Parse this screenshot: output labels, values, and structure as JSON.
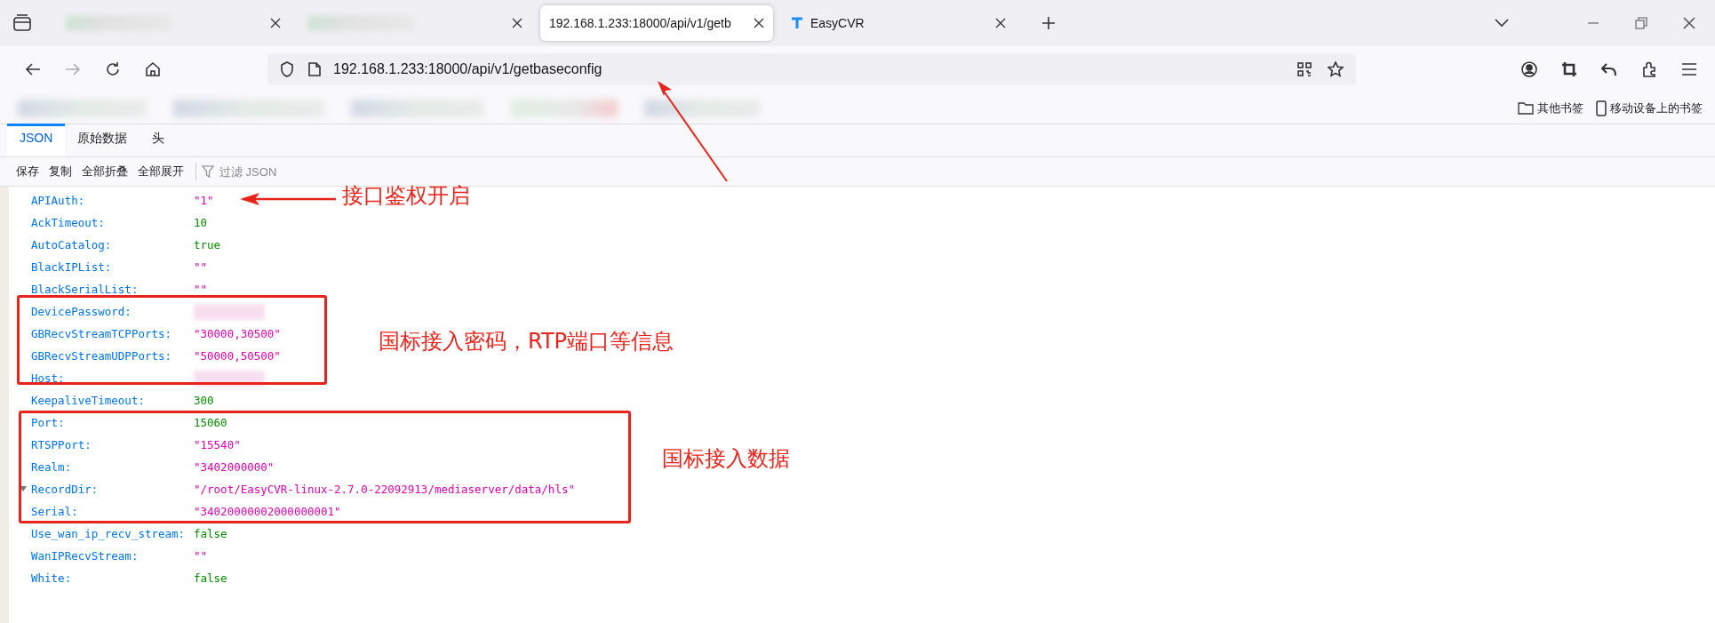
{
  "browser": {
    "tabs": [
      {
        "kind": "blurred",
        "selected": false
      },
      {
        "kind": "blurred",
        "selected": false
      },
      {
        "kind": "page",
        "title": "192.168.1.233:18000/api/v1/getb",
        "selected": true
      },
      {
        "kind": "page",
        "title": "EasyCVR",
        "selected": false
      }
    ],
    "url": "192.168.1.233:18000/api/v1/getbaseconfig",
    "bookmark_folders": [
      {
        "kind": "folder",
        "label": "其他书签"
      },
      {
        "kind": "mobile",
        "label": "移动设备上的书签"
      }
    ]
  },
  "viewer": {
    "tabs": [
      {
        "label": "JSON",
        "selected": true
      },
      {
        "label": "原始数据",
        "selected": false
      },
      {
        "label": "头",
        "selected": false
      }
    ],
    "toolbar": [
      "保存",
      "复制",
      "全部折叠",
      "全部展开"
    ],
    "filter": {
      "placeholder": "过滤 JSON"
    },
    "rows": [
      {
        "key": "APIAuth:",
        "value": "\"1\"",
        "kind": "string"
      },
      {
        "key": "AckTimeout:",
        "value": "10",
        "kind": "number"
      },
      {
        "key": "AutoCatalog:",
        "value": "true",
        "kind": "boolean"
      },
      {
        "key": "BlackIPList:",
        "value": "\"\"",
        "kind": "string"
      },
      {
        "key": "BlackSerialList:",
        "value": "\"\"",
        "kind": "string"
      },
      {
        "key": "DevicePassword:",
        "kind": "redacted"
      },
      {
        "key": "GBRecvStreamTCPPorts:",
        "value": "\"30000,30500\"",
        "kind": "string"
      },
      {
        "key": "GBRecvStreamUDPPorts:",
        "value": "\"50000,50500\"",
        "kind": "string"
      },
      {
        "key": "Host:",
        "kind": "redacted"
      },
      {
        "key": "KeepaliveTimeout:",
        "value": "300",
        "kind": "number"
      },
      {
        "key": "Port:",
        "value": "15060",
        "kind": "number"
      },
      {
        "key": "RTSPPort:",
        "value": "\"15540\"",
        "kind": "string"
      },
      {
        "key": "Realm:",
        "value": "\"3402000000\"",
        "kind": "string"
      },
      {
        "key": "RecordDir:",
        "value": "\"/root/EasyCVR-linux-2.7.0-22092913/mediaserver/data/hls\"",
        "kind": "string"
      },
      {
        "key": "Serial:",
        "value": "\"34020000002000000001\"",
        "kind": "string"
      },
      {
        "key": "Use_wan_ip_recv_stream:",
        "value": "false",
        "kind": "boolean"
      },
      {
        "key": "WanIPRecvStream:",
        "value": "\"\"",
        "kind": "string"
      },
      {
        "key": "White:",
        "value": "false",
        "kind": "boolean"
      }
    ]
  },
  "annotations": [
    {
      "text": "接口鉴权开启"
    },
    {
      "text": "国标接入密码，RTP端口等信息"
    },
    {
      "text": "国标接入数据"
    }
  ]
}
